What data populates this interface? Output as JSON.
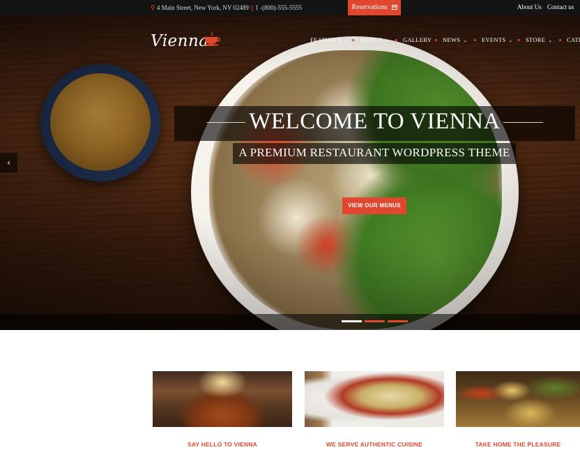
{
  "topbar": {
    "address": "4 Main Street, New York, NY 02489",
    "phone": "1 -(800)-555-5555",
    "reservations_label": "Reservations",
    "about_label": "About Us",
    "contact_label": "Contact us"
  },
  "header": {
    "logo_text": "Vienna",
    "nav": [
      {
        "label": "FEATURES",
        "has_dropdown": true
      },
      {
        "label": "MENUS",
        "has_dropdown": true
      },
      {
        "label": "GALLERY",
        "has_dropdown": false
      },
      {
        "label": "NEWS",
        "has_dropdown": true
      },
      {
        "label": "EVENTS",
        "has_dropdown": true
      },
      {
        "label": "STORE",
        "has_dropdown": true
      },
      {
        "label": "CATE",
        "has_dropdown": false
      }
    ]
  },
  "slider": {
    "heading": "WELCOME TO VIENNA",
    "subheading": "A PREMIUM RESTAURANT WORDPRESS THEME",
    "cta_label": "VIEW OUR MENUS",
    "prev_glyph": "‹",
    "slides_total": 3,
    "active_slide": 1
  },
  "features": [
    {
      "title": "SAY HELLO TO VIENNA"
    },
    {
      "title": "WE SERVE AUTHENTIC CUISINE"
    },
    {
      "title": "TAKE HOME THE PLEASURE"
    }
  ],
  "colors": {
    "accent": "#e0472e",
    "topbar_bg": "#141414",
    "text_light": "#ffffff"
  },
  "icons": {
    "address": "map-pin-icon",
    "phone": "phone-icon",
    "reservations": "calendar-icon",
    "logo": "coffee-cup-icon",
    "dropdown": "chevron-down-icon",
    "prev": "chevron-left-icon"
  }
}
